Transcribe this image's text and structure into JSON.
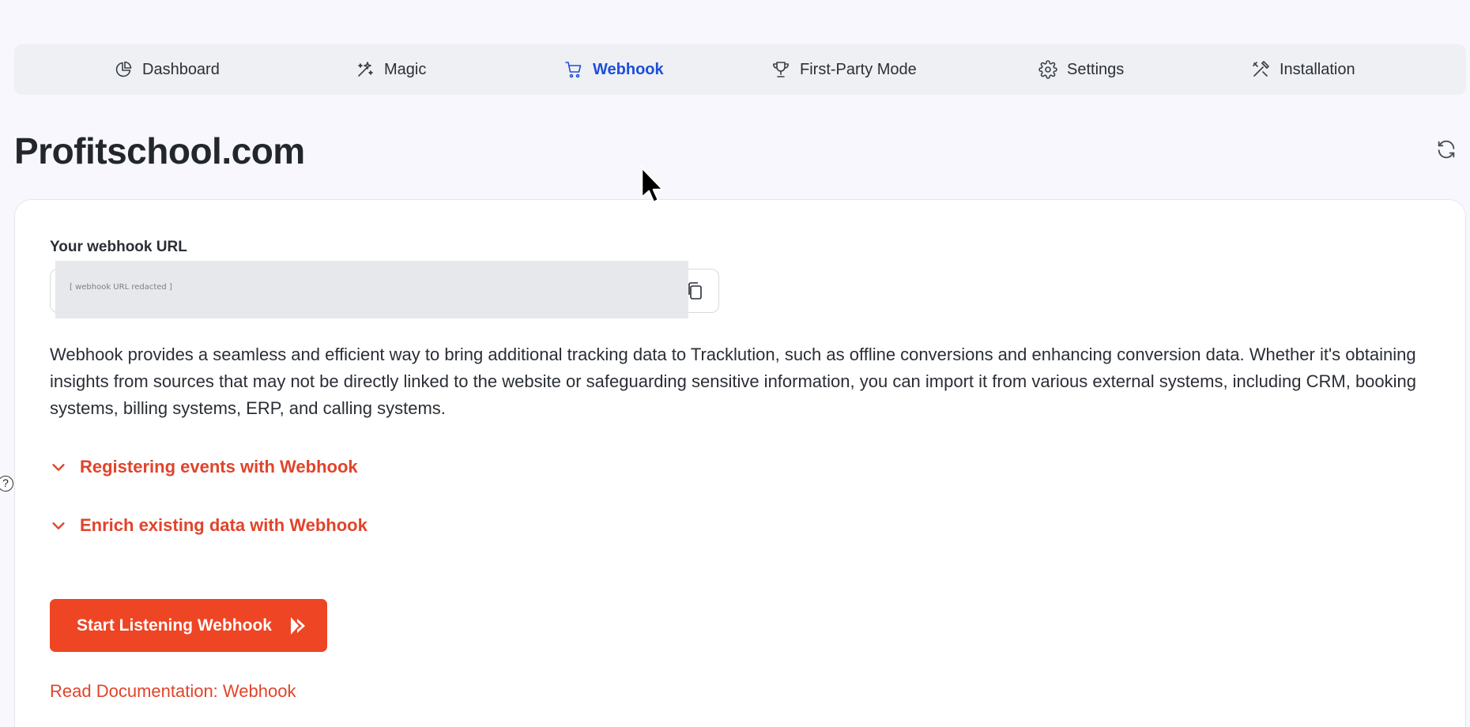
{
  "nav": {
    "items": [
      {
        "label": "Dashboard",
        "icon": "pie-chart-icon",
        "active": false
      },
      {
        "label": "Magic",
        "icon": "magic-wand-icon",
        "active": false
      },
      {
        "label": "Webhook",
        "icon": "shopping-cart-icon",
        "active": true
      },
      {
        "label": "First-Party Mode",
        "icon": "trophy-icon",
        "active": false
      },
      {
        "label": "Settings",
        "icon": "gear-icon",
        "active": false
      },
      {
        "label": "Installation",
        "icon": "tools-icon",
        "active": false
      }
    ],
    "active_color": "#1d4fd8"
  },
  "page": {
    "title": "Profitschool.com",
    "refresh_icon": "refresh-icon",
    "help_icon": "?"
  },
  "webhook": {
    "label": "Your webhook URL",
    "url_value": "[ webhook URL redacted ]",
    "copy_icon": "copy-icon"
  },
  "description": "Webhook provides a seamless and efficient way to bring additional tracking data to Tracklution, such as offline conversions and enhancing conversion data. Whether it's obtaining insights from sources that may not be directly linked to the website or safeguarding sensitive information, you can import it from various external systems, including CRM, booking systems, billing systems, ERP, and calling systems.",
  "accordions": [
    {
      "label": "Registering events with Webhook"
    },
    {
      "label": "Enrich existing data with Webhook"
    }
  ],
  "actions": {
    "start_label": "Start Listening Webhook",
    "doc_link": "Read Documentation: Webhook"
  },
  "colors": {
    "accent": "#ee4525",
    "link": "#e0442b",
    "background": "#f8f7fd"
  }
}
